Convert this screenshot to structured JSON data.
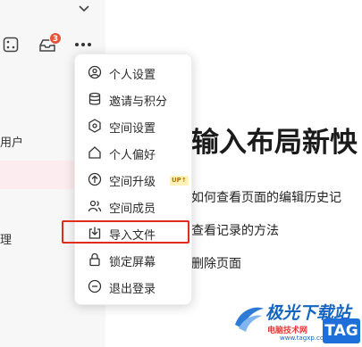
{
  "sidebar": {
    "badge_count": "3",
    "item_users": "用户",
    "item_manage": "理"
  },
  "main": {
    "title": "输入布局新怏",
    "items": [
      "如何查看页面的编辑历史记",
      "查看记录的方法",
      "删除页面"
    ]
  },
  "menu": {
    "items": [
      {
        "label": "个人设置",
        "icon": "user-circle-icon"
      },
      {
        "label": "邀请与积分",
        "icon": "database-icon"
      },
      {
        "label": "空间设置",
        "icon": "hexagon-settings-icon"
      },
      {
        "label": "个人偏好",
        "icon": "home-icon"
      },
      {
        "label": "空间升级",
        "icon": "upgrade-arrow-icon",
        "badge": "UP↑"
      },
      {
        "label": "空间成员",
        "icon": "members-icon"
      },
      {
        "label": "导入文件",
        "icon": "import-icon"
      },
      {
        "label": "锁定屏幕",
        "icon": "lock-icon"
      },
      {
        "label": "退出登录",
        "icon": "logout-icon"
      }
    ],
    "highlighted_index": 6
  },
  "watermark": {
    "title": "极光下载站",
    "subtitle": "电脑技术网",
    "url": "www.tagxp.com",
    "tag": "TAG"
  },
  "colors": {
    "highlight_border": "#e02b20",
    "badge": "#e5533d",
    "sidebar_bg": "#f7f7f7"
  }
}
